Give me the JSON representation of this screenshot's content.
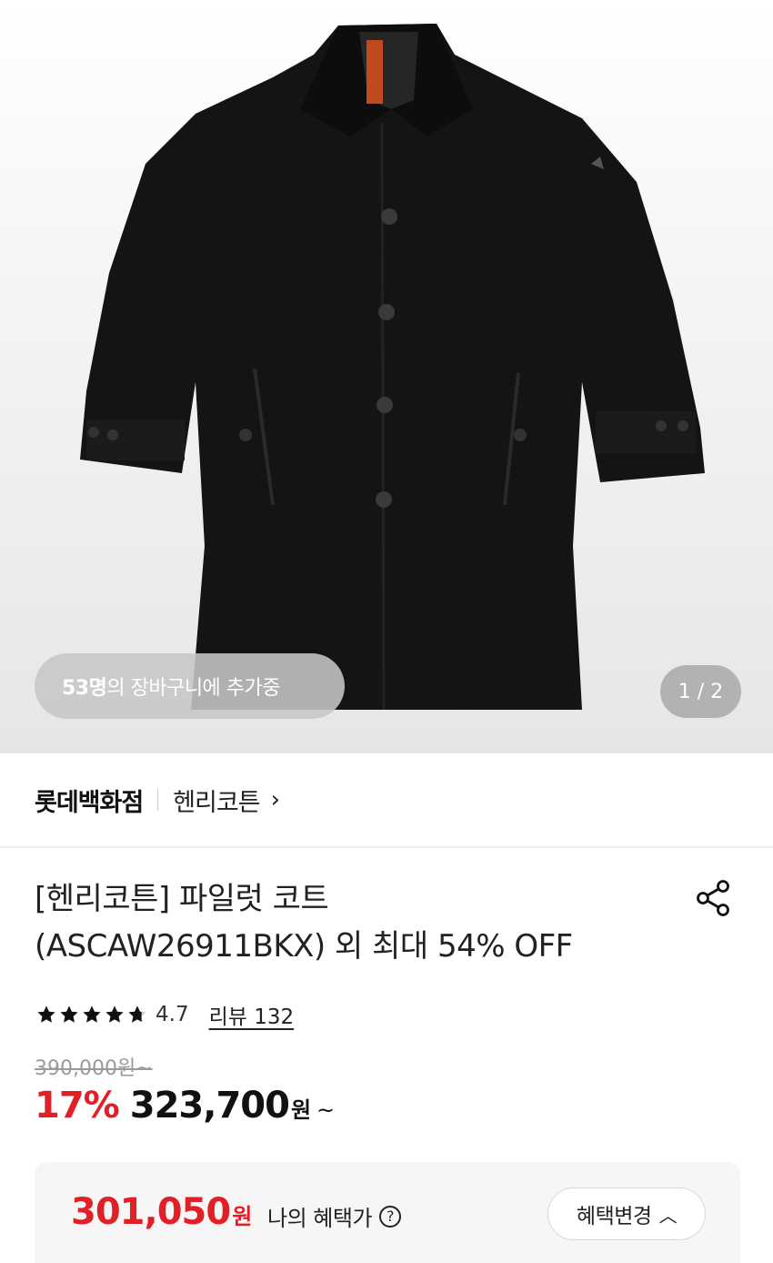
{
  "hero": {
    "cart_count": "53명",
    "cart_text": "의 장바구니에 추가중",
    "page_indicator": "1 / 2"
  },
  "store": {
    "name": "롯데백화점",
    "brand": "헨리코튼"
  },
  "product": {
    "title_line1": "[헨리코튼] 파일럿 코트",
    "title_line2": "(ASCAW26911BKX) 외 최대 54% OFF",
    "rating_score": "4.7",
    "rating_stars": 4.7,
    "review_label": "리뷰 132"
  },
  "price": {
    "original": "390,000원~",
    "discount": "17%",
    "sale": "323,700",
    "currency": "원",
    "tilde": "~"
  },
  "benefit": {
    "amount": "301,050",
    "currency": "원",
    "label": "나의 혜택가",
    "button_label": "혜택변경"
  },
  "icons": {
    "share": "share-icon",
    "chevron_right": "chevron-right-icon",
    "chevron_up": "chevron-up-icon",
    "help": "question-circle-icon"
  },
  "colors": {
    "accent": "#e21f26",
    "text": "#111111"
  }
}
